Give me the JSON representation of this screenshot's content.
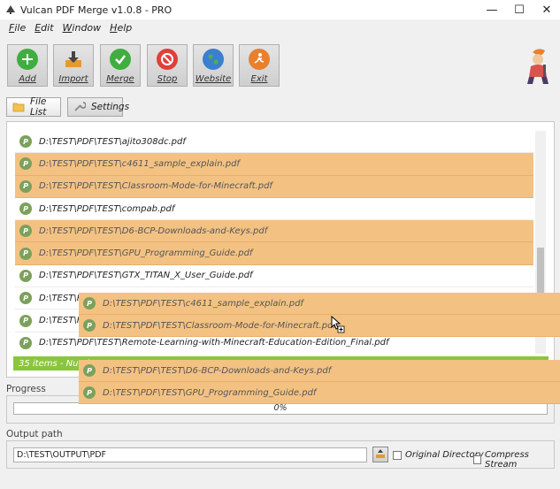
{
  "window": {
    "title": "Vulcan PDF Merge v1.0.8 - PRO",
    "minimize": "—",
    "maximize": "☐",
    "close": "✕"
  },
  "menu": {
    "items": [
      {
        "label": "File"
      },
      {
        "label": "Edit"
      },
      {
        "label": "Window"
      },
      {
        "label": "Help"
      }
    ]
  },
  "toolbar": {
    "buttons": [
      {
        "label": "Add",
        "icon": "plus-icon",
        "color": "#3fae3f"
      },
      {
        "label": "Import",
        "icon": "import-icon",
        "color": "#e59b2c"
      },
      {
        "label": "Merge",
        "icon": "check-icon",
        "color": "#3fae3f"
      },
      {
        "label": "Stop",
        "icon": "stop-icon",
        "color": "#e0403a"
      },
      {
        "label": "Website",
        "icon": "globe-icon",
        "color": "#3a7fd0"
      },
      {
        "label": "Exit",
        "icon": "exit-icon",
        "color": "#e8802e"
      }
    ]
  },
  "tabs": [
    {
      "label": "File List",
      "icon": "folder-icon",
      "active": true
    },
    {
      "label": "Settings",
      "icon": "wrench-icon",
      "active": false
    }
  ],
  "file_list": {
    "rows": [
      {
        "path": "D:\\TEST\\PDF\\TEST\\ajito308dc.pdf",
        "selected": false
      },
      {
        "path": "D:\\TEST\\PDF\\TEST\\c4611_sample_explain.pdf",
        "selected": true
      },
      {
        "path": "D:\\TEST\\PDF\\TEST\\Classroom-Mode-for-Minecraft.pdf",
        "selected": true
      },
      {
        "path": "D:\\TEST\\PDF\\TEST\\compab.pdf",
        "selected": false
      },
      {
        "path": "D:\\TEST\\PDF\\TEST\\D6-BCP-Downloads-and-Keys.pdf",
        "selected": true
      },
      {
        "path": "D:\\TEST\\PDF\\TEST\\GPU_Programming_Guide.pdf",
        "selected": true
      },
      {
        "path": "D:\\TEST\\PDF\\TEST\\GTX_TITAN_X_User_Guide.pdf",
        "selected": false
      },
      {
        "path": "D:\\TEST\\PDF",
        "selected": false
      },
      {
        "path": "D:\\TEST\\PDF",
        "selected": false
      },
      {
        "path": "D:\\TEST\\PDF\\TEST\\Remote-Learning-with-Minecraft-Education-Edition_Final.pdf",
        "selected": false
      }
    ],
    "status": "35 items - Numbe",
    "file_icon_letter": "P"
  },
  "drag_items": [
    {
      "path": "D:\\TEST\\PDF\\TEST\\c4611_sample_explain.pdf"
    },
    {
      "path": "D:\\TEST\\PDF\\TEST\\Classroom-Mode-for-Minecraft.pdf"
    },
    {
      "path": "D:\\TEST\\PDF\\TEST\\D6-BCP-Downloads-and-Keys.pdf"
    },
    {
      "path": "D:\\TEST\\PDF\\TEST\\GPU_Programming_Guide.pdf"
    }
  ],
  "progress": {
    "label": "Progress",
    "value": 0,
    "text": "0%"
  },
  "output": {
    "label": "Output path",
    "path": "D:\\TEST\\OUTPUT\\PDF",
    "original_directory": "Original Directory",
    "compress_stream": "Compress Stream"
  },
  "colors": {
    "selection": "#f3c283",
    "status_green": "#8ac53e",
    "pdf_icon": "#7ca15a"
  }
}
